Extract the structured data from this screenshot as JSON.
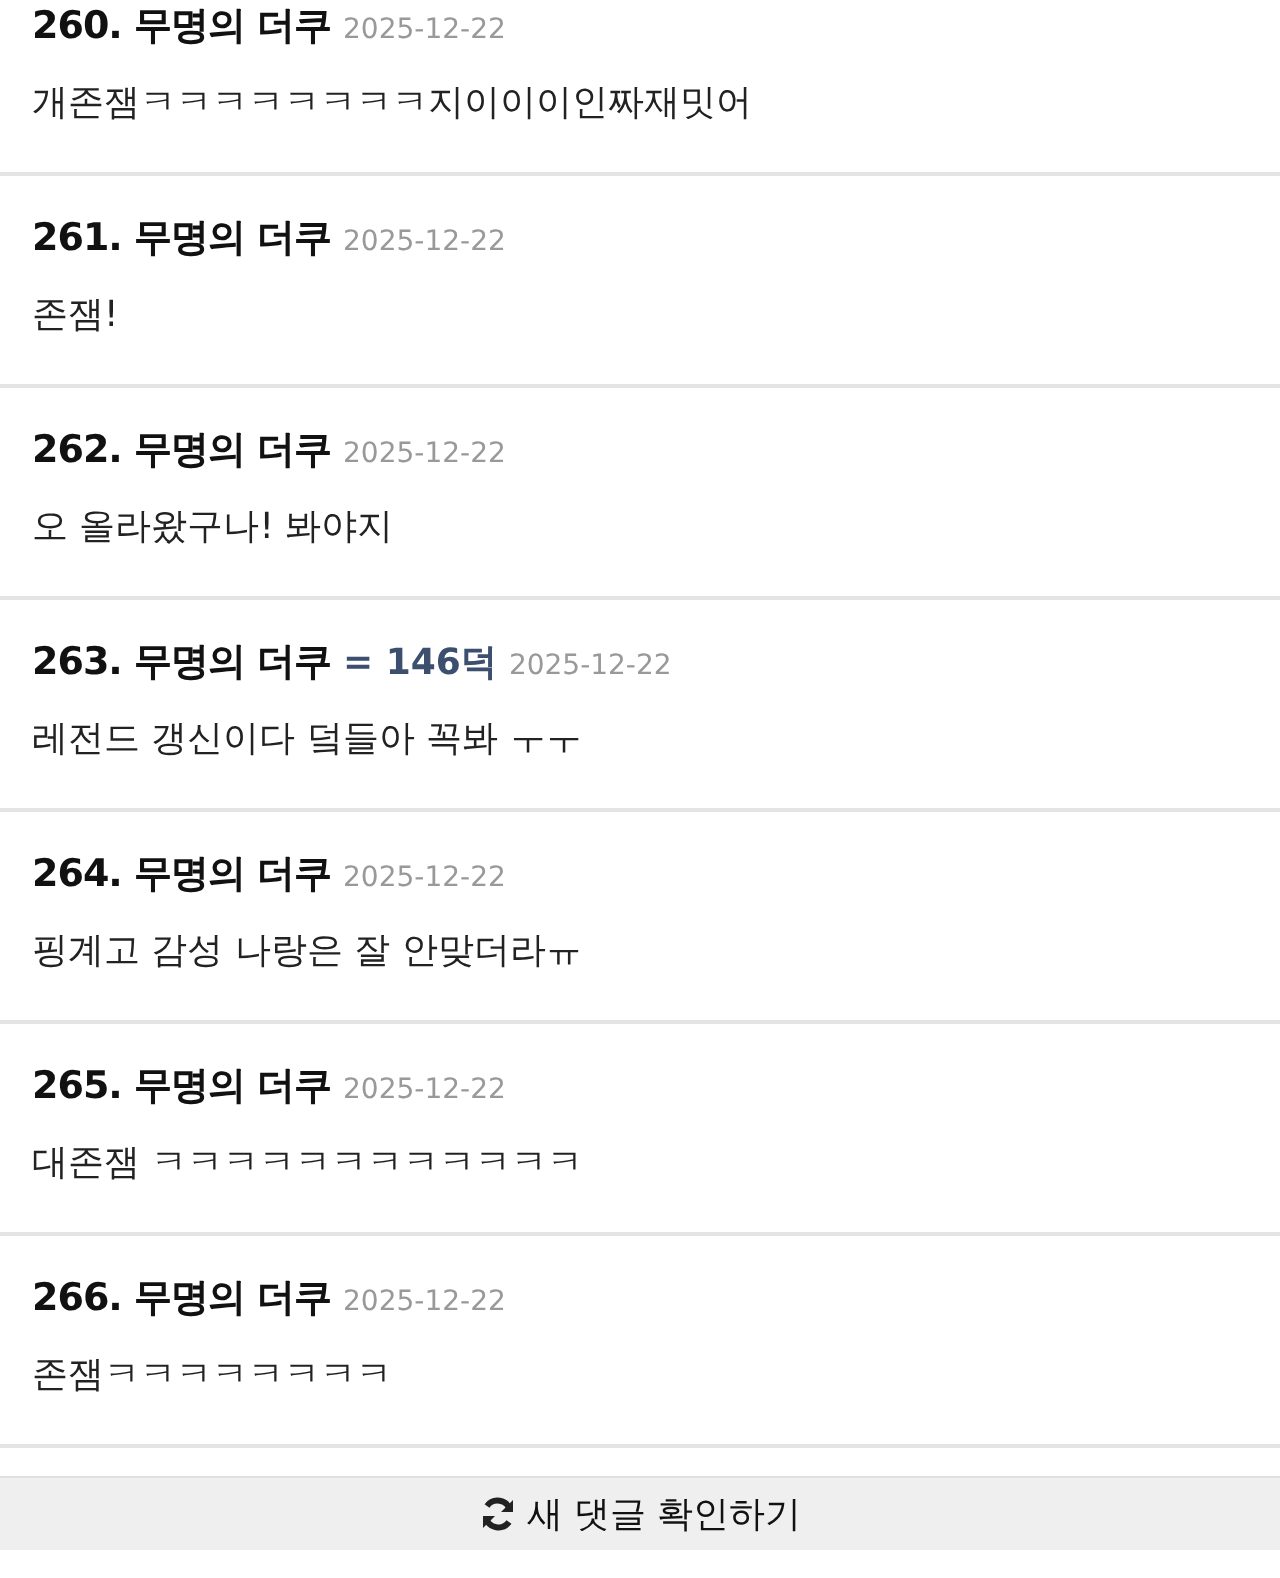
{
  "comments": [
    {
      "number": "260.",
      "author": "무명의 더쿠",
      "date": "2025-12-22",
      "text": "개존잼ㅋㅋㅋㅋㅋㅋㅋㅋ지이이이인짜재밋어"
    },
    {
      "number": "261.",
      "author": "무명의 더쿠",
      "date": "2025-12-22",
      "text": "존잼!"
    },
    {
      "number": "262.",
      "author": "무명의 더쿠",
      "date": "2025-12-22",
      "text": "오 올라왔구나! 봐야지"
    },
    {
      "number": "263.",
      "author": "무명의 더쿠",
      "points": "= 146덕",
      "date": "2025-12-22",
      "text": "레전드 갱신이다 덬들아 꼭봐 ㅜㅜ"
    },
    {
      "number": "264.",
      "author": "무명의 더쿠",
      "date": "2025-12-22",
      "text": "핑계고 감성 나랑은 잘 안맞더라ㅠ"
    },
    {
      "number": "265.",
      "author": "무명의 더쿠",
      "date": "2025-12-22",
      "text": "대존잼 ㅋㅋㅋㅋㅋㅋㅋㅋㅋㅋㅋㅋ"
    },
    {
      "number": "266.",
      "author": "무명의 더쿠",
      "date": "2025-12-22",
      "text": "존잼ㅋㅋㅋㅋㅋㅋㅋㅋ"
    }
  ],
  "refresh_button": {
    "label": "새 댓글 확인하기"
  }
}
